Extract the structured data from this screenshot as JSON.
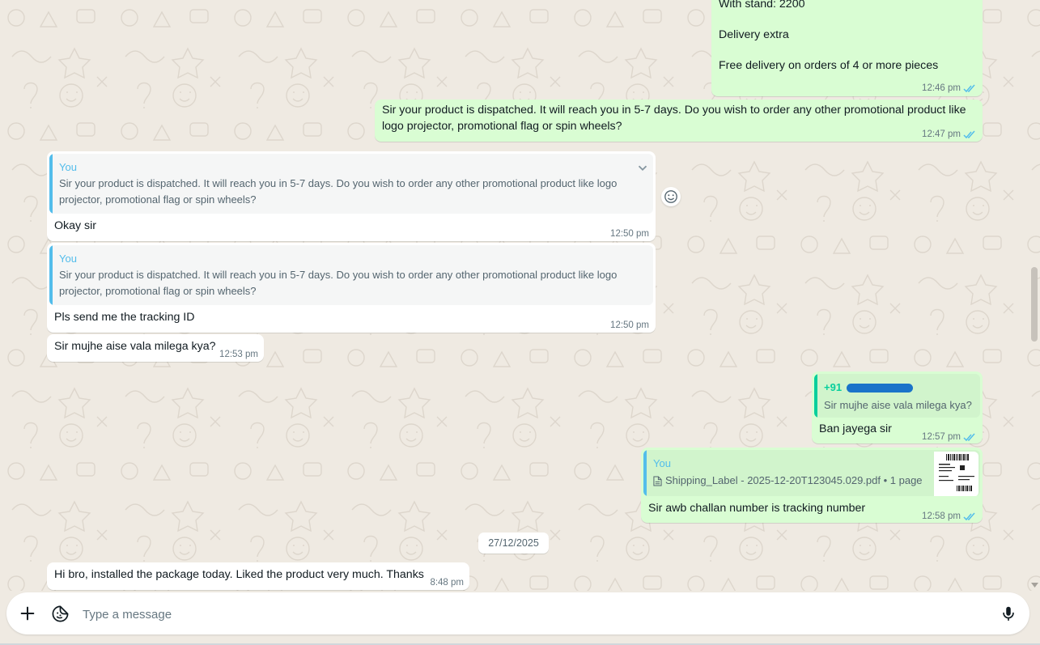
{
  "messages": [
    {
      "id": "m1",
      "direction": "out",
      "lines": [
        "With stand: 2200",
        "",
        "Delivery extra",
        "",
        "Free delivery on orders of 4 or more pieces"
      ],
      "time": "12:46 pm",
      "status": "read"
    },
    {
      "id": "m2",
      "direction": "out",
      "lines": [
        "Sir your product is dispatched. It will reach you in 5-7 days. Do you wish to order any other promotional product like",
        "logo projector, promotional flag or spin wheels?"
      ],
      "time": "12:47 pm",
      "status": "read"
    },
    {
      "id": "m3",
      "direction": "in",
      "quote": {
        "author": "You",
        "lines": [
          "Sir your product is dispatched. It will reach you in 5-7 days. Do you wish to order any other promotional product like logo",
          "projector, promotional flag or spin wheels?"
        ]
      },
      "text": "Okay sir",
      "time": "12:50 pm"
    },
    {
      "id": "m4",
      "direction": "in",
      "quote": {
        "author": "You",
        "lines": [
          "Sir your product is dispatched. It will reach you in 5-7 days. Do you wish to order any other promotional product like logo",
          "projector, promotional flag or spin wheels?"
        ]
      },
      "text": "Pls send me the tracking ID",
      "time": "12:50 pm"
    },
    {
      "id": "m5",
      "direction": "in",
      "text": "Sir mujhe aise vala milega kya?",
      "time": "12:53 pm"
    },
    {
      "id": "m6",
      "direction": "out",
      "quote": {
        "author": "+91",
        "lines": [
          "Sir mujhe aise vala milega kya?"
        ]
      },
      "text": "Ban jayega sir",
      "time": "12:57 pm",
      "status": "read"
    },
    {
      "id": "m7",
      "direction": "out",
      "quote": {
        "author": "You",
        "file": "Shipping_Label - 2025-12-20T123045.029.pdf • 1 page"
      },
      "text": "Sir awb challan number is tracking number",
      "time": "12:58 pm",
      "status": "read"
    },
    {
      "id": "m8",
      "direction": "in",
      "text": "Hi bro, installed the package today. Liked the product very much. Thanks",
      "time": "8:48 pm"
    }
  ],
  "date_divider": "27/12/2025",
  "composer": {
    "placeholder": "Type a message"
  },
  "colors": {
    "outgoing_bubble": "#d9fdd3",
    "incoming_bubble": "#ffffff",
    "read_tick": "#53bdeb",
    "chat_background": "#efeae2",
    "quote_bar_in": "#53bdeb",
    "quote_bar_green": "#06cf9c"
  },
  "icons": {
    "attach": "plus-icon",
    "sticker": "sticker-icon",
    "mic": "microphone-icon",
    "react": "emoji-icon",
    "reply_menu": "chevron-down-icon",
    "read_status": "double-check-icon",
    "document": "document-icon"
  }
}
